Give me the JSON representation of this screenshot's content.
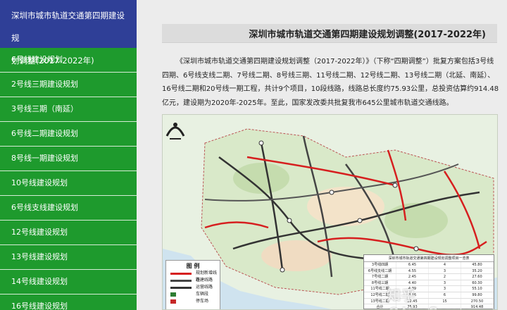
{
  "sidebar": {
    "header": [
      "深圳市城市轨道交通第四期建设规",
      "划调整(2017-2022年)"
    ],
    "items": [
      {
        "label": "6号线建设规划"
      },
      {
        "label": "2号线三期建设规划"
      },
      {
        "label": "3号线三期（南延）"
      },
      {
        "label": "6号线二期建设规划"
      },
      {
        "label": "8号线一期建设规划"
      },
      {
        "label": "10号线建设规划"
      },
      {
        "label": "6号线支线建设规划"
      },
      {
        "label": "12号线建设规划"
      },
      {
        "label": "13号线建设规划"
      },
      {
        "label": "14号线建设规划"
      },
      {
        "label": "16号线建设规划"
      }
    ]
  },
  "main": {
    "title": "深圳市城市轨道交通第四期建设规划调整(2017-2022年)",
    "paragraph": "《深圳市城市轨道交通第四期建设规划调整（2017-2022年）》（下称“四期调整”）批复方案包括3号线四期、6号线支线二期、7号线二期、8号线三期、11号线二期、12号线二期、13号线二期（北延、南延）、16号线二期和20号线一期工程，共计9个项目，10段线路，线路总长度约75.93公里，总投资估算约914.48亿元，建设期为2020年-2025年。至此，国家发改委共批复我市645公里城市轨道交通线路。"
  },
  "map": {
    "legend_title": "图  例",
    "legend_items": [
      {
        "label": "规划新增线路",
        "color": "#d61f1f"
      },
      {
        "label": "在建线路",
        "color": "#444444"
      },
      {
        "label": "运营线路",
        "color": "#333333"
      },
      {
        "label": "车辆段",
        "color": "#2e7d32"
      },
      {
        "label": "停车场",
        "color": "#c62828"
      }
    ],
    "table_title": "深圳市城市轨道交通第四期建设规划调整项目一览表",
    "table_rows": [
      [
        "3号线四期",
        "6.45",
        "4",
        "45.80"
      ],
      [
        "6号线支线二期",
        "4.55",
        "3",
        "35.20"
      ],
      [
        "7号线二期",
        "2.45",
        "2",
        "27.60"
      ],
      [
        "8号线三期",
        "4.40",
        "3",
        "60.30"
      ],
      [
        "11号线二期",
        "4.39",
        "3",
        "55.10"
      ],
      [
        "12号线二期",
        "8.16",
        "6",
        "99.80"
      ],
      [
        "13号线二期",
        "22.45",
        "15",
        "270.50"
      ],
      [
        "合计",
        "75.93",
        "",
        "914.48"
      ]
    ],
    "watermark": "知乎 @JimSoup",
    "accent_colors": {
      "sidebar_header": "#2f3f97",
      "sidebar_item": "#1e9a2d"
    }
  }
}
